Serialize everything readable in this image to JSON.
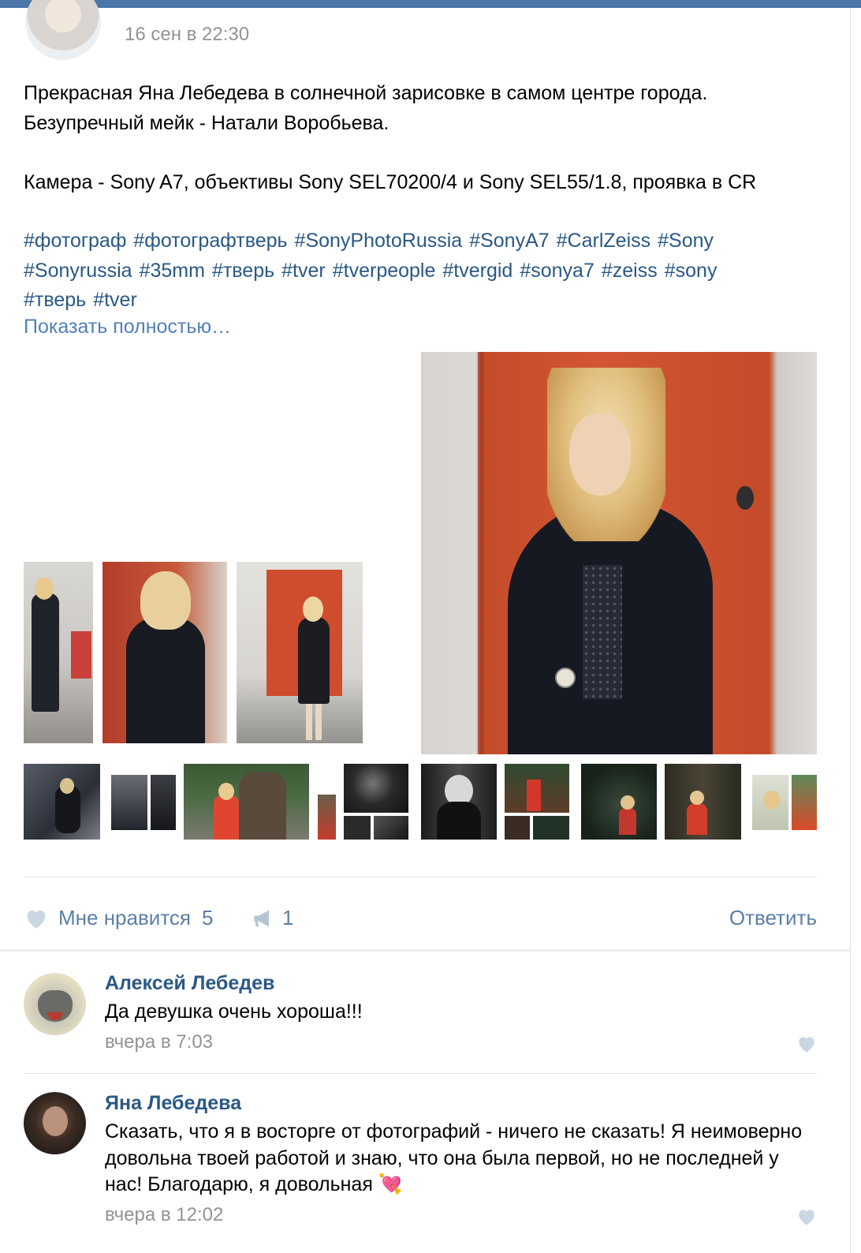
{
  "post": {
    "date": "16 сен в 22:30",
    "text": "Прекрасная Яна Лебедева в солнечной зарисовке в самом центре города.\nБезупречный мейк - Натали Воробьева.\n\nКамера - Sony A7, объективы Sony SEL70200/4 и Sony SEL55/1.8, проявка в CR",
    "hashtags": [
      "#фотограф",
      "#фотографтверь",
      "#SonyPhotoRussia",
      "#SonyA7",
      "#CarlZeiss",
      "#Sony",
      "#Sonyrussia",
      "#35mm",
      "#тверь",
      "#tver",
      "#tverpeople",
      "#tvergid",
      "#sonya7",
      "#zeiss",
      "#sony",
      "#тверь",
      "#tver"
    ],
    "show_more": "Показать полностью…"
  },
  "actions": {
    "like_label": "Мне нравится",
    "like_count": "5",
    "share_count": "1",
    "reply_label": "Ответить"
  },
  "comments": [
    {
      "author": "Алексей Лебедев",
      "text": "Да девушка очень хороша!!!",
      "date": "вчера в 7:03",
      "avatar": "wolf-avatar"
    },
    {
      "author": "Яна Лебедева",
      "text": "Сказать, что я в восторге от фотографий - ничего не сказать! Я неимоверно довольна твоей работой и знаю, что она была первой, но не последней у нас! Благодарю, я довольная",
      "emoji": "💘",
      "date": "вчера в 12:02",
      "avatar": "woman-avatar"
    }
  ],
  "colors": {
    "link": "#2a5885",
    "accent": "#5181b8",
    "muted": "#939393",
    "heart": "#cbd6e3",
    "topbar": "#4a76a8"
  },
  "icons": {
    "like": "heart-icon",
    "share": "megaphone-icon"
  }
}
